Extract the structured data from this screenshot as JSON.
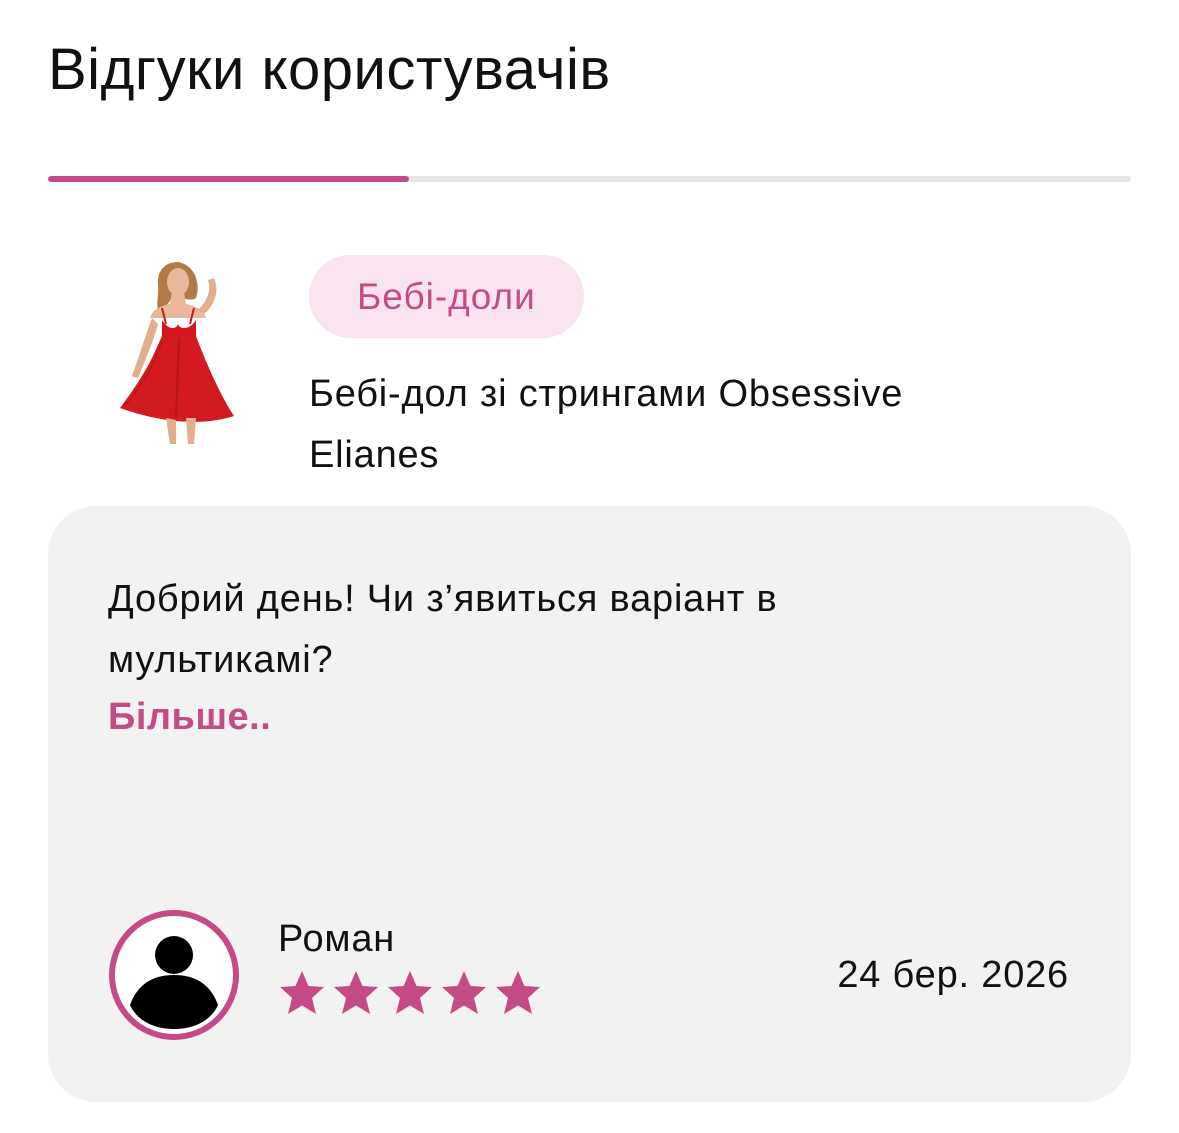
{
  "section": {
    "title": "Відгуки користувачів",
    "slider_progress": 0.333
  },
  "product": {
    "image_icon": "product-photo-red-babydoll",
    "category": "Бебі-доли",
    "name": "Бебі-дол зі стрингами Obsessive Elianes"
  },
  "review": {
    "text": "Добрий день! Чи з’явиться варіант в мультикамі?",
    "more_label": "Більше..",
    "author": {
      "name": "Роман",
      "avatar_icon": "user-avatar-icon"
    },
    "rating": 5,
    "rating_max": 5,
    "date": "24 бер. 2026"
  },
  "colors": {
    "accent": "#c54b86",
    "chip_bg": "#f8e3ee",
    "card_bg": "#f2f2f2",
    "track": "#e6e6e6"
  }
}
